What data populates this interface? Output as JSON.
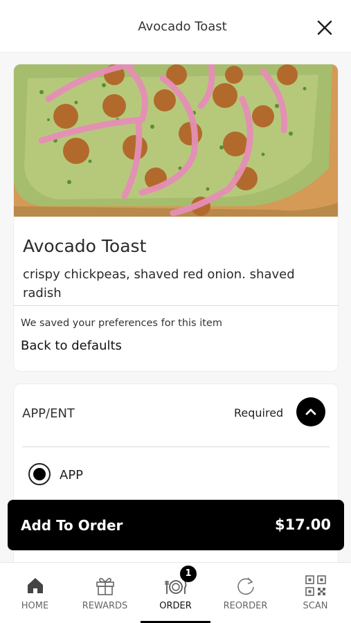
{
  "header": {
    "title": "Avocado Toast",
    "close_icon": "close-icon"
  },
  "item": {
    "name": "Avocado Toast",
    "description": "crispy chickpeas, shaved red onion. shaved radish",
    "saved_message": "We saved your preferences for this item",
    "back_to_defaults": "Back to defaults"
  },
  "option_group": {
    "title": "APP/ENT",
    "required_label": "Required",
    "options": [
      {
        "label": "APP",
        "selected": true
      }
    ]
  },
  "add_to_order": {
    "label": "Add To Order",
    "price": "$17.00"
  },
  "nav": {
    "items": [
      {
        "label": "HOME",
        "icon": "home-icon"
      },
      {
        "label": "REWARDS",
        "icon": "gift-icon"
      },
      {
        "label": "ORDER",
        "icon": "plate-utensils-icon",
        "badge": "1",
        "active": true
      },
      {
        "label": "REORDER",
        "icon": "refresh-icon"
      },
      {
        "label": "SCAN",
        "icon": "qr-code-icon"
      }
    ]
  },
  "colors": {
    "primary": "#000000",
    "background": "#f7f7f7",
    "card": "#ffffff"
  }
}
